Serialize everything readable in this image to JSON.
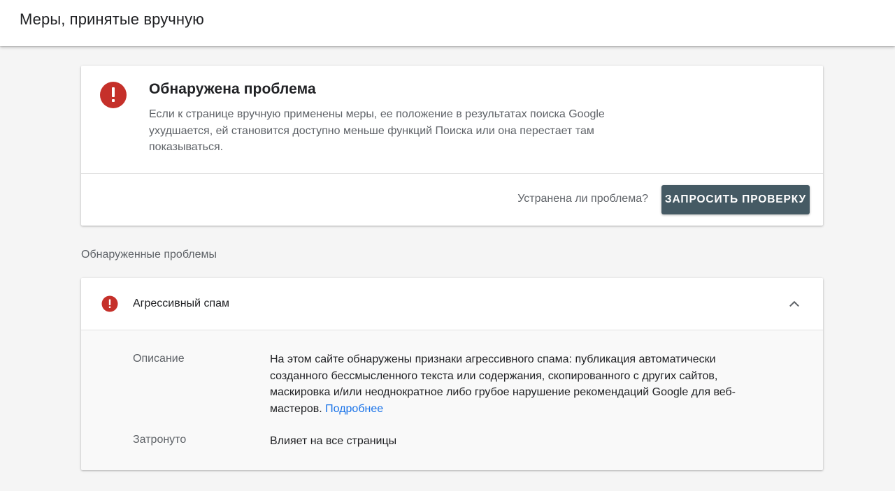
{
  "header": {
    "title": "Меры, принятые вручную"
  },
  "problem_card": {
    "icon": "error-icon",
    "title": "Обнаружена проблема",
    "description": "Если к странице вручную применены меры, ее положение в результатах поиска Google ухудшается, ей становится доступно меньше функций Поиска или она перестает там показываться.",
    "question": "Устранена ли проблема?",
    "button_label": "ЗАПРОСИТЬ ПРОВЕРКУ"
  },
  "issues_section": {
    "heading": "Обнаруженные проблемы",
    "issue": {
      "icon": "error-icon",
      "title": "Агрессивный спам",
      "expanded": true,
      "details": {
        "description_label": "Описание",
        "description_text": "На этом сайте обнаружены признаки агрессивного спама: публикация автоматически созданного бессмысленного текста или содержания, скопированного с других сайтов, маскировка и/или неоднократное либо грубое нарушение рекомендаций Google для веб-мастеров.",
        "learn_more": "Подробнее",
        "affected_label": "Затронуто",
        "affected_value": "Влияет на все страницы"
      }
    }
  },
  "colors": {
    "error_red": "#d93025",
    "button_bg": "#455a64",
    "link_blue": "#1a73e8",
    "page_bg": "#f5f5f5"
  }
}
